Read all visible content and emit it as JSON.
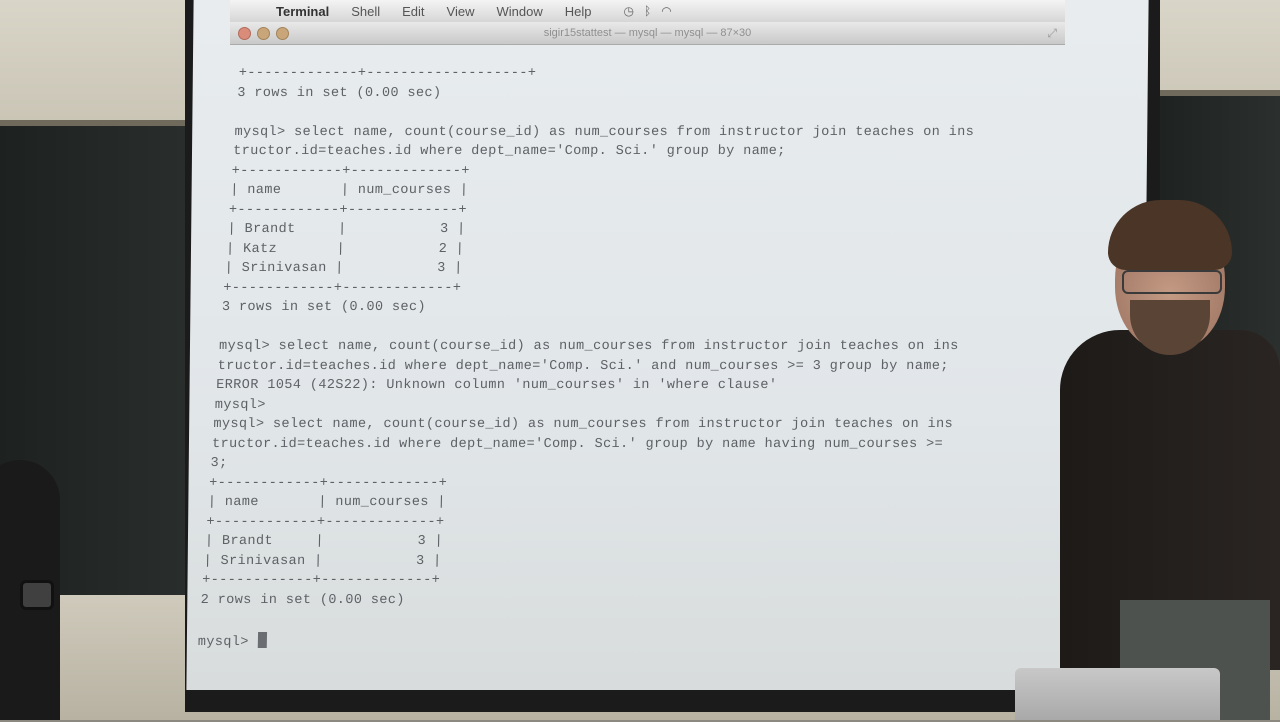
{
  "menubar": {
    "apple_icon": "apple-icon",
    "items": [
      "Terminal",
      "Shell",
      "Edit",
      "View",
      "Window",
      "Help"
    ]
  },
  "window": {
    "title": "sigir15stattest — mysql — mysql — 87×30"
  },
  "terminal": {
    "lines": [
      "+-------------+-------------------+",
      "3 rows in set (0.00 sec)",
      "",
      "mysql> select name, count(course_id) as num_courses from instructor join teaches on ins",
      "tructor.id=teaches.id where dept_name='Comp. Sci.' group by name;",
      "+------------+-------------+",
      "| name       | num_courses |",
      "+------------+-------------+",
      "| Brandt     |           3 |",
      "| Katz       |           2 |",
      "| Srinivasan |           3 |",
      "+------------+-------------+",
      "3 rows in set (0.00 sec)",
      "",
      "mysql> select name, count(course_id) as num_courses from instructor join teaches on ins",
      "tructor.id=teaches.id where dept_name='Comp. Sci.' and num_courses >= 3 group by name;",
      "ERROR 1054 (42S22): Unknown column 'num_courses' in 'where clause'",
      "mysql>",
      "mysql> select name, count(course_id) as num_courses from instructor join teaches on ins",
      "tructor.id=teaches.id where dept_name='Comp. Sci.' group by name having num_courses >=",
      "3;",
      "+------------+-------------+",
      "| name       | num_courses |",
      "+------------+-------------+",
      "| Brandt     |           3 |",
      "| Srinivasan |           3 |",
      "+------------+-------------+",
      "2 rows in set (0.00 sec)",
      "",
      "mysql> "
    ]
  },
  "colors": {
    "terminal_bg": "#e3e8eb",
    "terminal_text": "#5e6266"
  }
}
